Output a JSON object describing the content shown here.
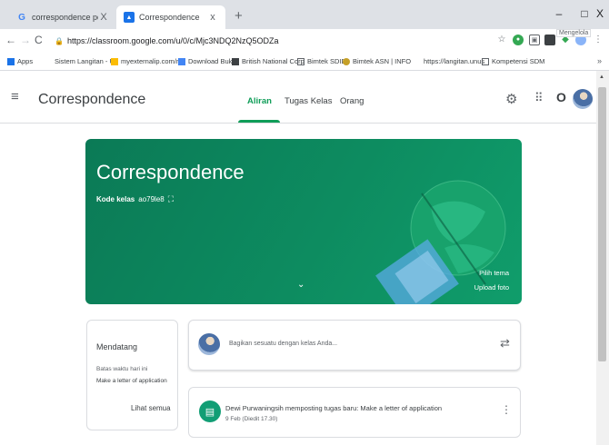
{
  "browser": {
    "tabs": [
      {
        "label": "correspondence pdf - Penelusur",
        "favicon": "google-icon",
        "close": "X"
      },
      {
        "label": "Correspondence",
        "favicon": "classroom-icon",
        "close": "x"
      }
    ],
    "new_tab": "+",
    "window_buttons": {
      "minimize": "–",
      "maximize": "□",
      "close": "X"
    },
    "nav": {
      "back": "←",
      "forward": "→",
      "reload": "C"
    },
    "url": "https://classroom.google.com/u/0/c/Mjc3NDQ2NzQ5ODZa",
    "tooltip": "Mengelola",
    "bookmarks": [
      {
        "label": "Apps",
        "color": "#1a73e8"
      },
      {
        "label": "Sistem Langitan - Un",
        "color": "#ffffff"
      },
      {
        "label": "myexternalip.com/ra",
        "color": "#fbbc04"
      },
      {
        "label": "Download Buku",
        "color": "#4285f4"
      },
      {
        "label": "British National Corp",
        "color": "#3c4043"
      },
      {
        "label": "Bimtek SDID",
        "color": "#ffffff"
      },
      {
        "label": "Bimtek ASN | INFO",
        "color": "#c5a028"
      },
      {
        "label": "https://langitan.unus",
        "color": "#ffffff"
      },
      {
        "label": "Kompetensi SDM",
        "color": "#ffffff"
      }
    ],
    "bookmarks_more": "»"
  },
  "header": {
    "menu_icon": "≡",
    "title": "Correspondence",
    "tabs": [
      {
        "label": "Aliran",
        "active": true
      },
      {
        "label": "Tugas Kelas",
        "active": false
      },
      {
        "label": "Orang",
        "active": false
      }
    ],
    "apps_icon": "⋮⋮⋮",
    "account_letter": "O"
  },
  "banner": {
    "title": "Correspondence",
    "code_label": "Kode kelas",
    "code_value": "ao79le8",
    "select_theme": "Pilih tema",
    "upload_photo": "Upload foto",
    "color": "#0d8c60"
  },
  "upcoming": {
    "title": "Mendatang",
    "due_today": "Batas waktu hari ini",
    "item": "Make a letter of application",
    "view_all": "Lihat semua"
  },
  "share": {
    "placeholder": "Bagikan sesuatu dengan kelas Anda..."
  },
  "post": {
    "title": "Dewi Purwaningsih memposting tugas baru: Make a letter of application",
    "date": "9 Feb (Diedit 17.30)"
  }
}
